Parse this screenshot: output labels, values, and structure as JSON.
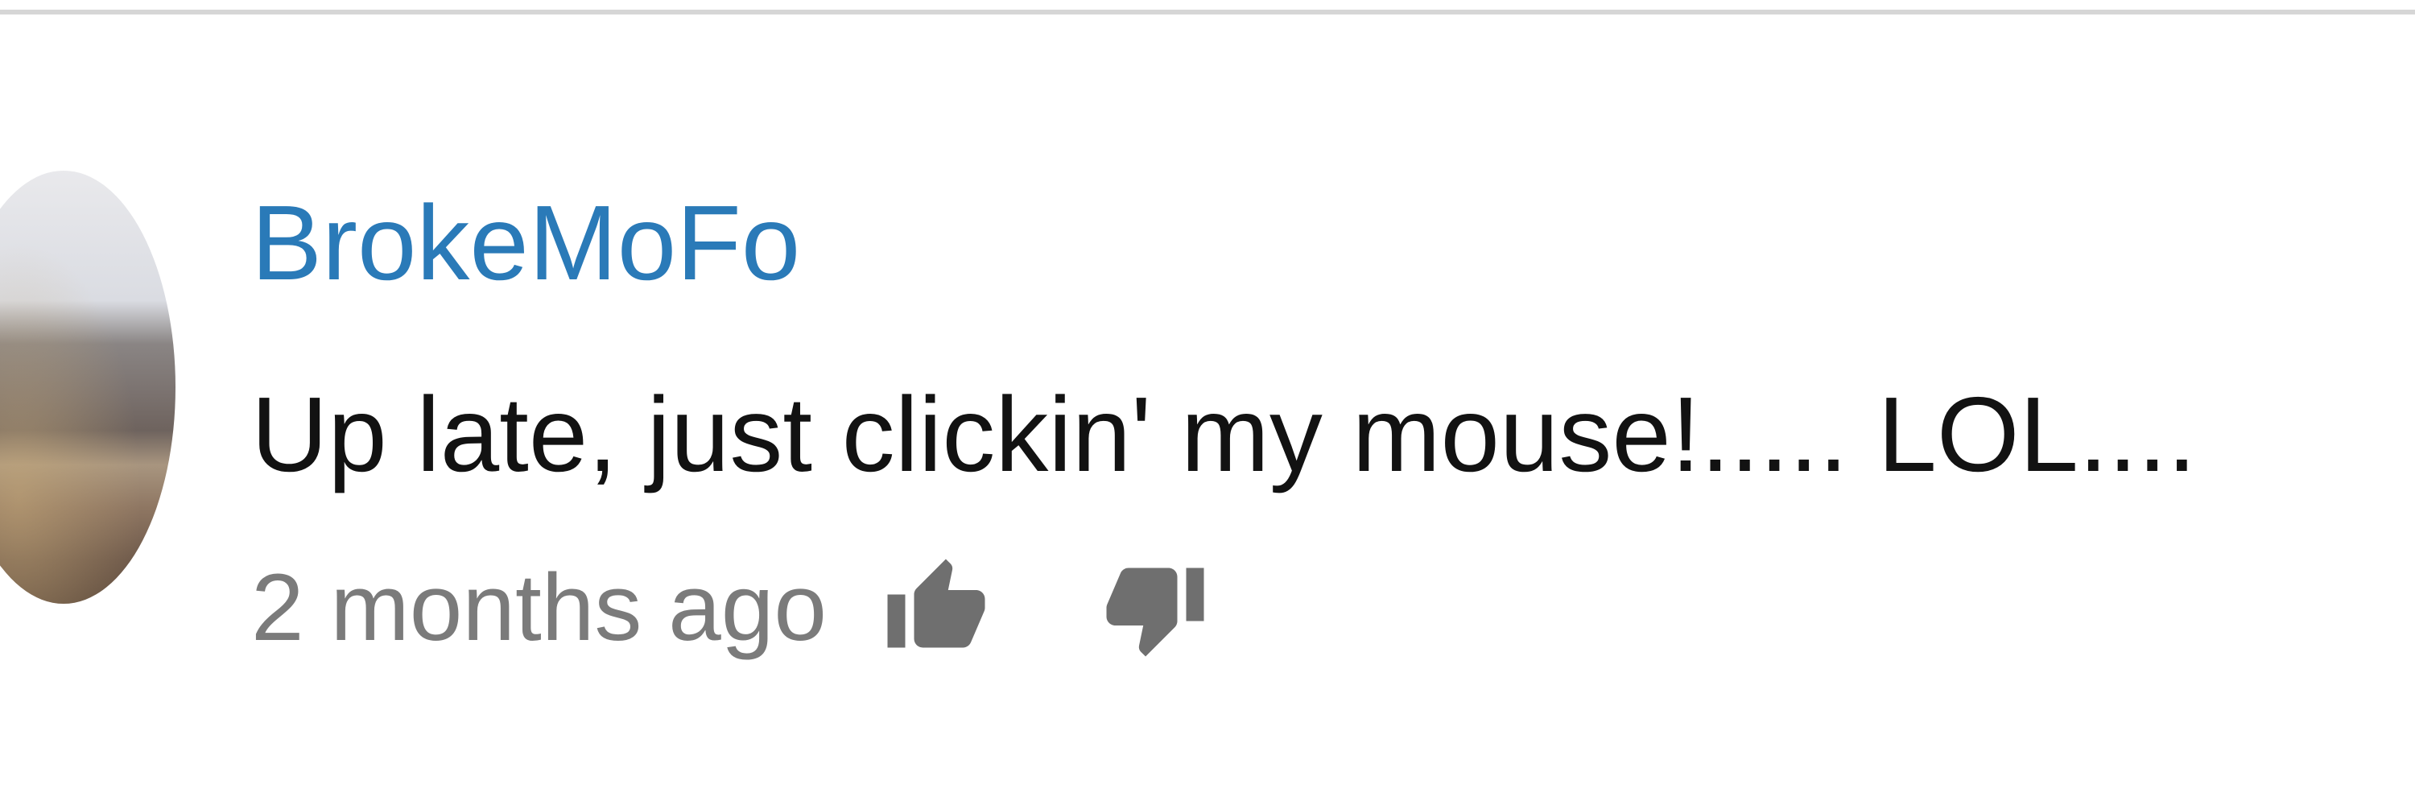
{
  "comment": {
    "author": "BrokeMoFo",
    "text": "Up late, just clickin' my mouse!..... LOL....",
    "timestamp": "2 months ago",
    "actions": {
      "like_icon": "thumbs-up-icon",
      "dislike_icon": "thumbs-down-icon"
    }
  },
  "colors": {
    "author": "#2a7ab8",
    "text": "#121212",
    "meta": "#7b7b7b",
    "icon": "#6f6f6f",
    "divider": "#d6d6d6"
  }
}
